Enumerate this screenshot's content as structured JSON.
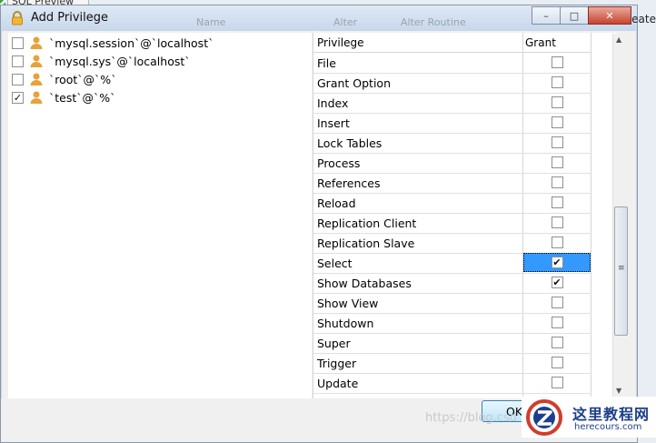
{
  "background": {
    "tab_label": "SQL Preview",
    "header_cols": [
      "Name",
      "Alter",
      "Alter Routine",
      "Create"
    ],
    "right_text": "eate"
  },
  "dialog": {
    "title": "Add Privilege",
    "title_icon": "lock-icon",
    "window_buttons": {
      "minimize": "minimize-icon",
      "maximize": "maximize-icon",
      "close": "close-icon"
    }
  },
  "users": [
    {
      "label": "`mysql.session`@`localhost`",
      "checked": false
    },
    {
      "label": "`mysql.sys`@`localhost`",
      "checked": false
    },
    {
      "label": "`root`@`%`",
      "checked": false
    },
    {
      "label": "`test`@`%`",
      "checked": true
    }
  ],
  "grid": {
    "headers": {
      "privilege": "Privilege",
      "grant": "Grant"
    },
    "rows": [
      {
        "name": "File",
        "granted": false,
        "selected": false
      },
      {
        "name": "Grant Option",
        "granted": false,
        "selected": false
      },
      {
        "name": "Index",
        "granted": false,
        "selected": false
      },
      {
        "name": "Insert",
        "granted": false,
        "selected": false
      },
      {
        "name": "Lock Tables",
        "granted": false,
        "selected": false
      },
      {
        "name": "Process",
        "granted": false,
        "selected": false
      },
      {
        "name": "References",
        "granted": false,
        "selected": false
      },
      {
        "name": "Reload",
        "granted": false,
        "selected": false
      },
      {
        "name": "Replication Client",
        "granted": false,
        "selected": false
      },
      {
        "name": "Replication Slave",
        "granted": false,
        "selected": false
      },
      {
        "name": "Select",
        "granted": true,
        "selected": true
      },
      {
        "name": "Show Databases",
        "granted": true,
        "selected": false
      },
      {
        "name": "Show View",
        "granted": false,
        "selected": false
      },
      {
        "name": "Shutdown",
        "granted": false,
        "selected": false
      },
      {
        "name": "Super",
        "granted": false,
        "selected": false
      },
      {
        "name": "Trigger",
        "granted": false,
        "selected": false
      },
      {
        "name": "Update",
        "granted": false,
        "selected": false
      }
    ]
  },
  "footer": {
    "ok_label": "OK",
    "watermark": "https://blog.csd",
    "badge_cn": "这里教程网",
    "badge_en": "herecours.com"
  },
  "colors": {
    "selection": "#3399ff",
    "user_icon": "#e8a23a",
    "badge_text": "#1d3f8a"
  }
}
